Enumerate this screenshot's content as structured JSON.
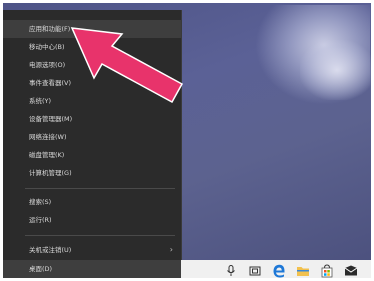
{
  "menu": {
    "items": [
      "应用和功能(F)",
      "移动中心(B)",
      "电源选项(O)",
      "事件查看器(V)",
      "系统(Y)",
      "设备管理器(M)",
      "网络连接(W)",
      "磁盘管理(K)",
      "计算机管理(G)",
      "搜索(S)",
      "运行(R)",
      "关机或注销(U)",
      "桌面(D)"
    ],
    "submenu_chevron": "›"
  },
  "taskbar": {
    "icons": [
      "microphone-icon",
      "task-view-icon",
      "edge-icon",
      "file-explorer-icon",
      "store-icon",
      "mail-icon"
    ]
  },
  "colors": {
    "menu_bg": "#2b2b2b",
    "menu_text": "#d9d9d9",
    "arrow": "#e8336b",
    "desktop": "#5a5f8e",
    "edge_blue": "#1e78d7",
    "folder_yellow": "#f2c14e"
  }
}
